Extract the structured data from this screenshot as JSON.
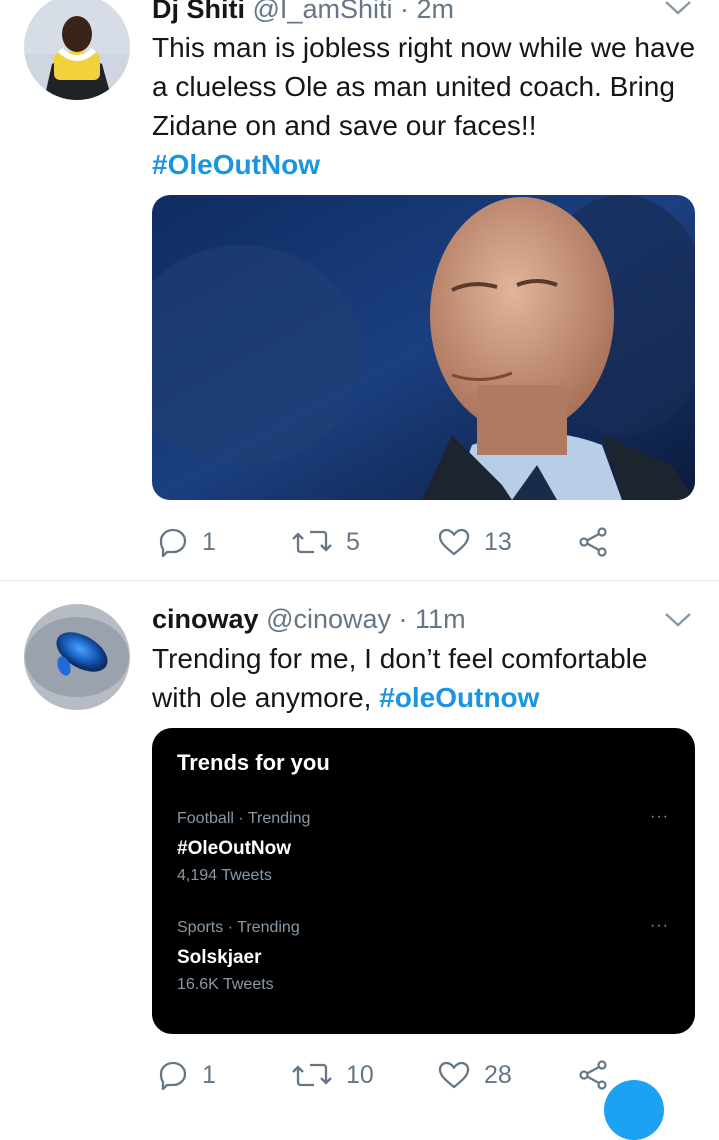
{
  "tweets": [
    {
      "name": "Dj Shiti",
      "handle": "@I_amShiti",
      "time": "· 2m",
      "text": "This man is jobless right now while we have a clueless Ole as man united coach. Bring Zidane on and save our faces!! ",
      "hashtag": "#OleOutNow",
      "replies": "1",
      "retweets": "5",
      "likes": "13"
    },
    {
      "name": "cinoway",
      "handle": "@cinoway",
      "time": "· 11m",
      "text": "Trending for me,  I don’t feel comfortable with ole anymore, ",
      "hashtag": "#oleOutnow",
      "replies": "1",
      "retweets": "10",
      "likes": "28"
    }
  ],
  "trends_card": {
    "title": "Trends for you",
    "items": [
      {
        "meta": "Football · Trending",
        "tag": "#OleOutNow",
        "count": "4,194 Tweets",
        "more": "···"
      },
      {
        "meta": "Sports · Trending",
        "tag": "Solskjaer",
        "count": "16.6K Tweets",
        "more": "···"
      }
    ]
  },
  "colors": {
    "accent": "#1b95e0",
    "secondary_text": "#657786",
    "divider": "#e1e8ed",
    "card_background": "#000000"
  },
  "icons": [
    "reply-icon",
    "retweet-icon",
    "like-icon",
    "share-icon",
    "chevron-down-icon"
  ]
}
